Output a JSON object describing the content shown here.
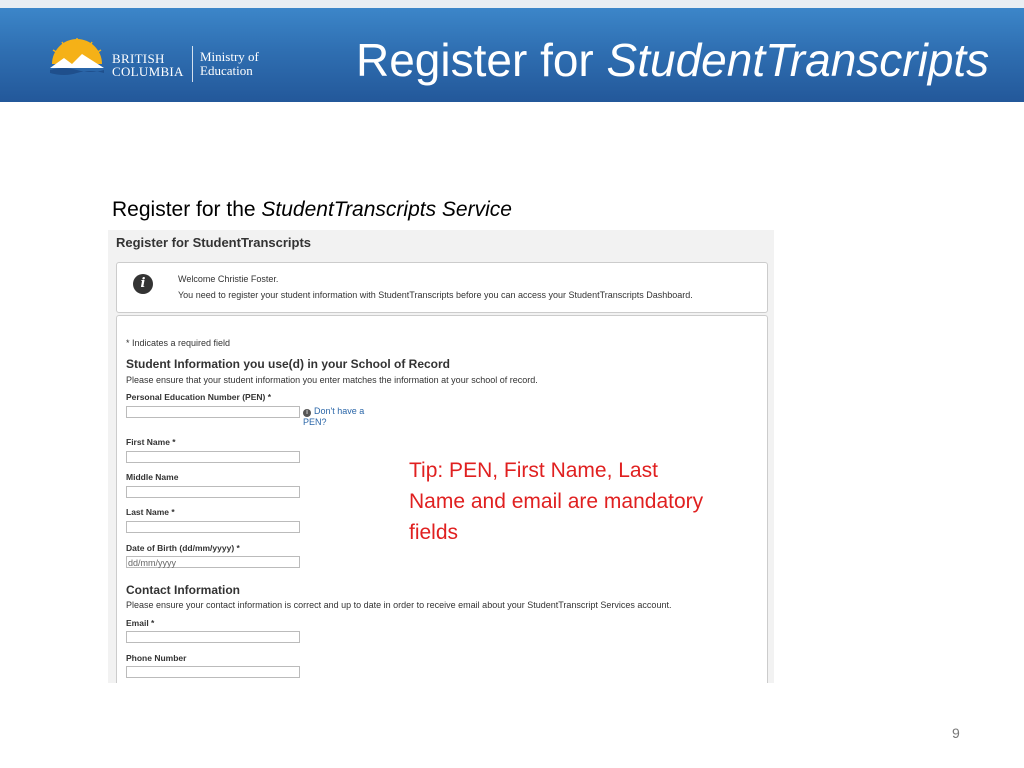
{
  "header": {
    "title_plain": "Register for ",
    "title_italic": "StudentTranscripts",
    "logo_line1": "BRITISH",
    "logo_line2": "COLUMBIA",
    "ministry_line1": "Ministry of",
    "ministry_line2": "Education"
  },
  "subtitle": {
    "plain": "Register for the ",
    "italic": "StudentTranscripts  Service"
  },
  "screen": {
    "title": "Register for StudentTranscripts",
    "welcome": "Welcome Christie Foster.",
    "message": "You need to register your student information with StudentTranscripts before you can access your StudentTranscripts Dashboard.",
    "required_note": "* Indicates a required field",
    "student_heading": "Student Information you use(d) in your School of Record",
    "student_desc": "Please ensure that your student information you enter matches the information at your school of record.",
    "pen_label": "Personal Education Number (PEN) *",
    "pen_help_line1": "Don't have a",
    "pen_help_line2": "PEN?",
    "first_name_label": "First Name *",
    "middle_name_label": "Middle Name",
    "last_name_label": "Last Name *",
    "dob_label": "Date of Birth (dd/mm/yyyy) *",
    "dob_placeholder": "dd/mm/yyyy",
    "contact_heading": "Contact Information",
    "contact_desc": "Please ensure your contact information is correct and up to date in order to receive email about your StudentTranscript Services account.",
    "email_label": "Email *",
    "phone_label": "Phone Number"
  },
  "tip": "Tip: PEN, First Name, Last Name and email are mandatory fields",
  "page_number": "9",
  "colors": {
    "banner": "#2f6fb2",
    "tip": "#e02020",
    "link": "#2a66a8"
  }
}
